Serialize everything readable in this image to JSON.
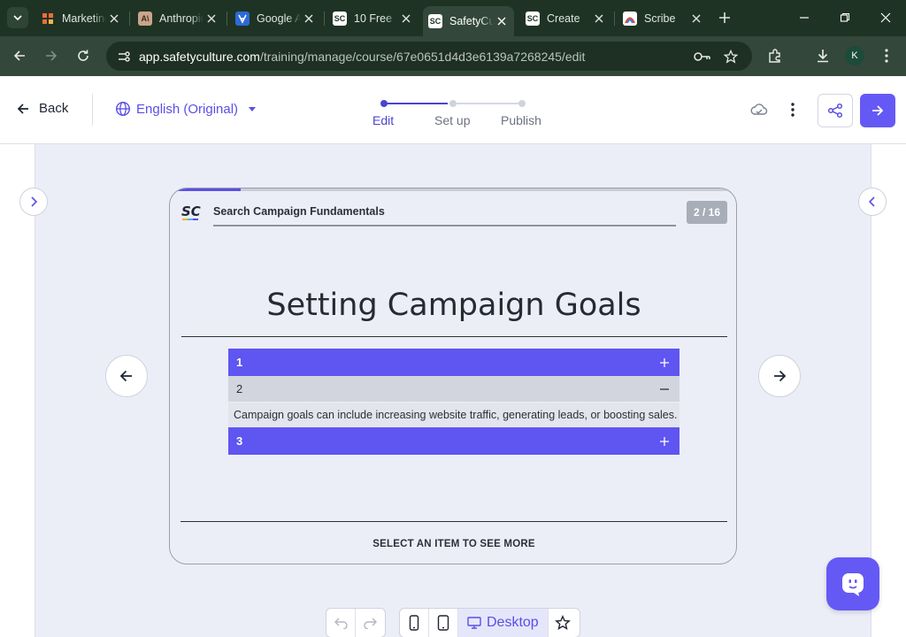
{
  "browser": {
    "tabs": [
      {
        "label": "Marketing",
        "icon": "grid-favicon",
        "active": false
      },
      {
        "label": "Anthropic",
        "icon": "anthropic-favicon",
        "active": false
      },
      {
        "label": "Google Ads",
        "icon": "google-ads-favicon",
        "active": false
      },
      {
        "label": "10 Free",
        "icon": "safetyculture-favicon",
        "active": false
      },
      {
        "label": "SafetyCulture",
        "icon": "safetyculture-favicon",
        "active": true
      },
      {
        "label": "Create",
        "icon": "safetyculture-favicon",
        "active": false
      },
      {
        "label": "Scribe",
        "icon": "scribe-favicon",
        "active": false
      }
    ],
    "url_host": "app.safetyculture.com",
    "url_path": "/training/manage/course/67e0651d4d3e6139a7268245/edit",
    "profile_initial": "K"
  },
  "header": {
    "back_label": "Back",
    "language": "English (Original)",
    "steps": [
      {
        "label": "Edit",
        "active": true
      },
      {
        "label": "Set up",
        "active": false
      },
      {
        "label": "Publish",
        "active": false
      }
    ]
  },
  "slide": {
    "course_title": "Search Campaign Fundamentals",
    "page_indicator": "2 / 16",
    "progress_fraction": 0.125,
    "logo_text": "SC",
    "title": "Setting Campaign Goals",
    "accordion": [
      {
        "label": "1",
        "expanded": false
      },
      {
        "label": "2",
        "expanded": true,
        "content": "Campaign goals can include increasing website traffic, generating leads, or boosting sales."
      },
      {
        "label": "3",
        "expanded": false
      }
    ],
    "hint": "SELECT AN ITEM TO SEE MORE"
  },
  "toolbar": {
    "view_label": "Desktop"
  },
  "colors": {
    "accent": "#5f55f1",
    "accent_dark": "#4b44d0",
    "chrome_bg": "#1f3324"
  }
}
